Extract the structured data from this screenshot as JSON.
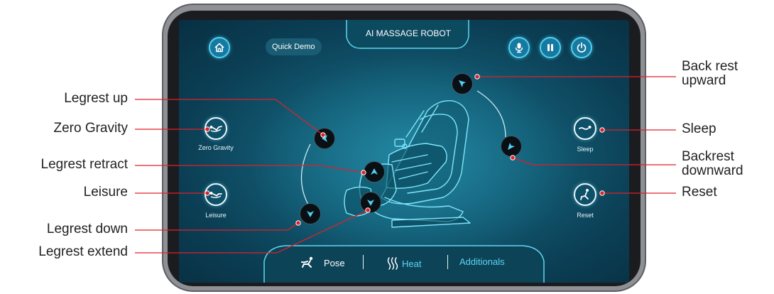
{
  "app": {
    "title": "AI MASSAGE ROBOT",
    "quick_demo": "Quick Demo"
  },
  "top_controls": [
    {
      "name": "home-button",
      "icon": "home-icon"
    },
    {
      "name": "microphone-button",
      "icon": "microphone-icon"
    },
    {
      "name": "pause-button",
      "icon": "pause-icon"
    },
    {
      "name": "power-button",
      "icon": "power-icon"
    }
  ],
  "modes": {
    "zero_gravity": "Zero Gravity",
    "leisure": "Leisure",
    "sleep": "Sleep",
    "reset": "Reset"
  },
  "bottom_tabs": {
    "pose": "Pose",
    "heat": "Heat",
    "additionals": "Additionals"
  },
  "callouts": {
    "legrest_up": "Legrest up",
    "zero_gravity": "Zero Gravity",
    "legrest_retract": "Legrest retract",
    "leisure": "Leisure",
    "legrest_down": "Legrest down",
    "legrest_extend": "Legrest extend",
    "back_rest_upward_1": "Back rest",
    "back_rest_upward_2": "upward",
    "sleep": "Sleep",
    "backrest_downward_1": "Backrest",
    "backrest_downward_2": "downward",
    "reset": "Reset"
  },
  "colors": {
    "accent": "#4fd1f0",
    "callout_line": "#e0202a",
    "heat_active": "#5fd3f3"
  }
}
